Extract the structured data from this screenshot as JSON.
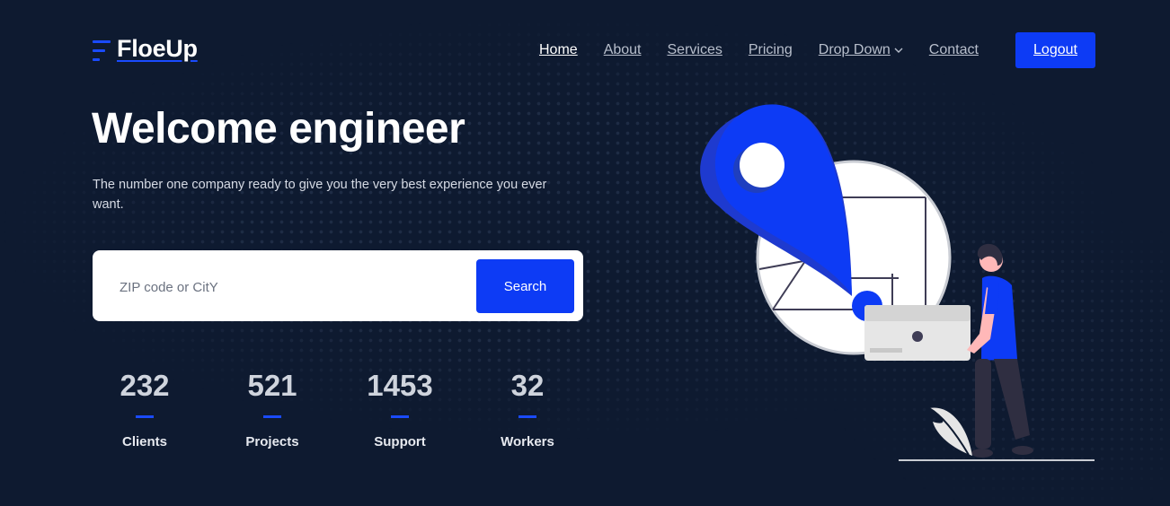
{
  "colors": {
    "background": "#0e1a30",
    "accent": "#0d3bf5",
    "accent_light": "#1a4bff"
  },
  "brand": {
    "name": "FloeUp",
    "icon": "menu-lines-icon"
  },
  "nav": {
    "items": [
      {
        "label": "Home",
        "active": true
      },
      {
        "label": "About",
        "active": false
      },
      {
        "label": "Services",
        "active": false
      },
      {
        "label": "Pricing",
        "active": false
      },
      {
        "label": "Drop Down",
        "active": false,
        "dropdown": true,
        "icon": "chevron-down-icon"
      },
      {
        "label": "Contact",
        "active": false
      }
    ],
    "logout_label": "Logout"
  },
  "hero": {
    "title": "Welcome engineer",
    "subtitle": "The number one company ready to give you the very best experience you ever want."
  },
  "search": {
    "placeholder": "ZIP code or CitY",
    "value": "",
    "button_label": "Search"
  },
  "stats": [
    {
      "value": "232",
      "label": "Clients"
    },
    {
      "value": "521",
      "label": "Projects"
    },
    {
      "value": "1453",
      "label": "Support"
    },
    {
      "value": "32",
      "label": "Workers"
    }
  ],
  "illustration": {
    "icon": "map-pin-person-illustration"
  }
}
